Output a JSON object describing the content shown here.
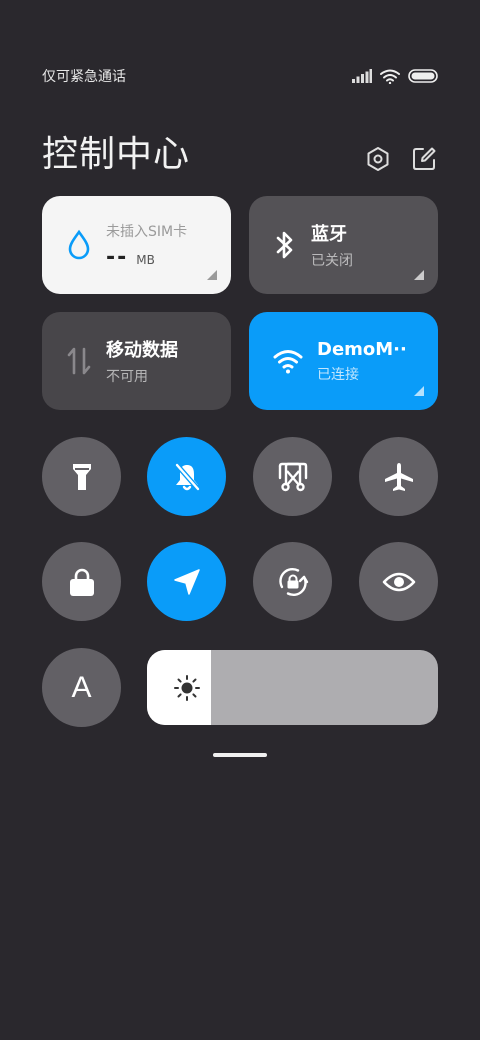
{
  "status_bar": {
    "carrier": "仅可紧急通话",
    "icons": [
      "signal-icon",
      "wifi-icon",
      "battery-icon"
    ]
  },
  "header": {
    "title": "控制中心",
    "actions": [
      "settings-icon",
      "edit-icon"
    ]
  },
  "tiles": {
    "sim": {
      "label": "未插入SIM卡",
      "value": "--",
      "unit": "MB",
      "icon": "droplet-icon"
    },
    "bluetooth": {
      "title": "蓝牙",
      "status": "已关闭",
      "icon": "bluetooth-icon"
    },
    "mobile_data": {
      "title": "移动数据",
      "status": "不可用",
      "icon": "data-arrows-icon"
    },
    "wifi": {
      "title": "DemoM··",
      "status": "已连接",
      "icon": "wifi-icon"
    }
  },
  "toggles": [
    {
      "name": "flashlight",
      "icon": "flashlight-icon",
      "active": false
    },
    {
      "name": "mute",
      "icon": "bell-off-icon",
      "active": true
    },
    {
      "name": "screenshot",
      "icon": "scissors-icon",
      "active": false
    },
    {
      "name": "airplane",
      "icon": "airplane-icon",
      "active": false
    },
    {
      "name": "lock",
      "icon": "lock-icon",
      "active": false
    },
    {
      "name": "location",
      "icon": "location-icon",
      "active": true
    },
    {
      "name": "rotation-lock",
      "icon": "rotation-lock-icon",
      "active": false
    },
    {
      "name": "eye-comfort",
      "icon": "eye-icon",
      "active": false
    },
    {
      "name": "auto-text",
      "icon": "letter-a-icon",
      "label": "A",
      "active": false
    }
  ],
  "brightness": {
    "level": 0.22,
    "icon": "sun-icon"
  },
  "colors": {
    "accent": "#0a9cf9",
    "background": "#2a282d",
    "tile": "#545256",
    "round": "#626065"
  }
}
